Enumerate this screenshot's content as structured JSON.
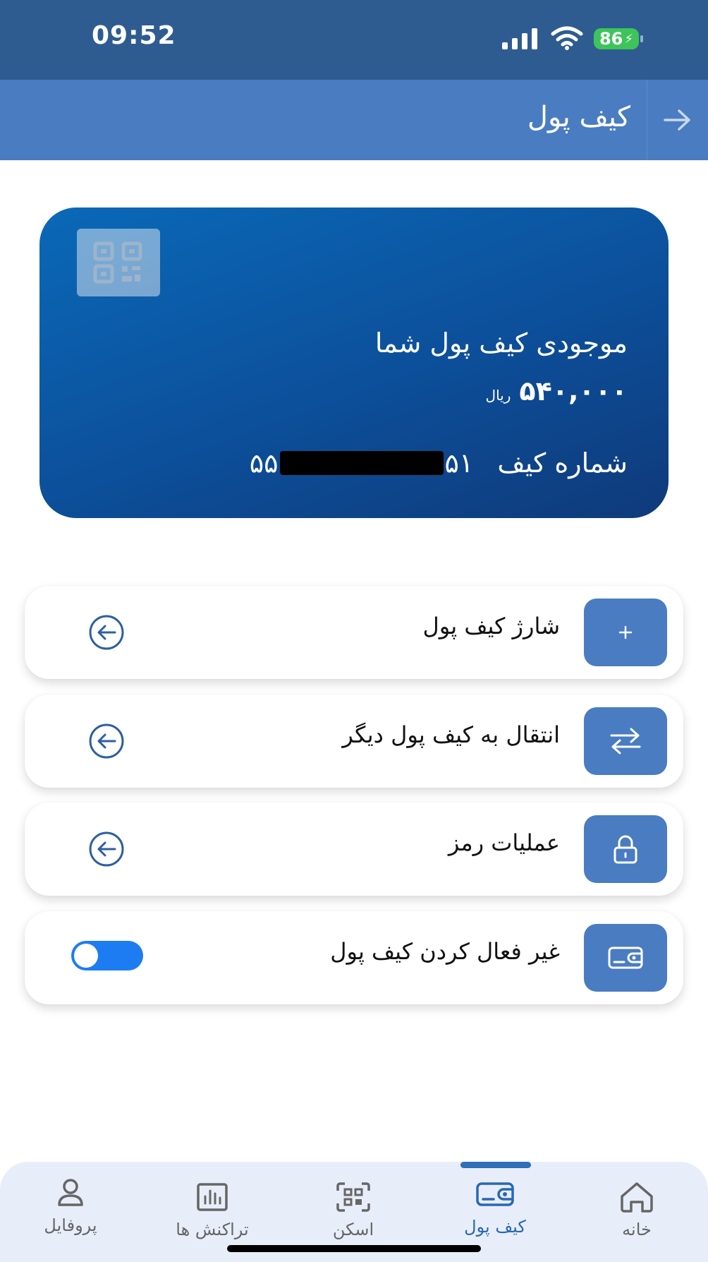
{
  "status_bar": {
    "time": "09:52",
    "battery": "86"
  },
  "header": {
    "title": "کیف پول"
  },
  "wallet_card": {
    "balance_label": "موجودی کیف پول شما",
    "amount": "۵۴۰,۰۰۰",
    "currency": "ریال",
    "number_label": "شماره کیف",
    "number_prefix": "۵۵",
    "number_suffix": "۵۱"
  },
  "menu": [
    {
      "label": "شارژ کیف پول",
      "icon": "plus-icon"
    },
    {
      "label": "انتقال به کیف پول دیگر",
      "icon": "transfer-icon"
    },
    {
      "label": "عملیات رمز",
      "icon": "lock-icon"
    },
    {
      "label": "غیر فعال کردن کیف پول",
      "icon": "wallet-icon",
      "toggle_on": true
    }
  ],
  "nav": {
    "home": "خانه",
    "wallet": "کیف پول",
    "scan": "اسکن",
    "transactions": "تراکنش ها",
    "profile": "پروفایل",
    "active": "wallet"
  },
  "colors": {
    "primary": "#4a7cc2",
    "status_bar": "#2e5c90",
    "toggle": "#1e7cf2",
    "active_nav": "#2a67b5"
  }
}
